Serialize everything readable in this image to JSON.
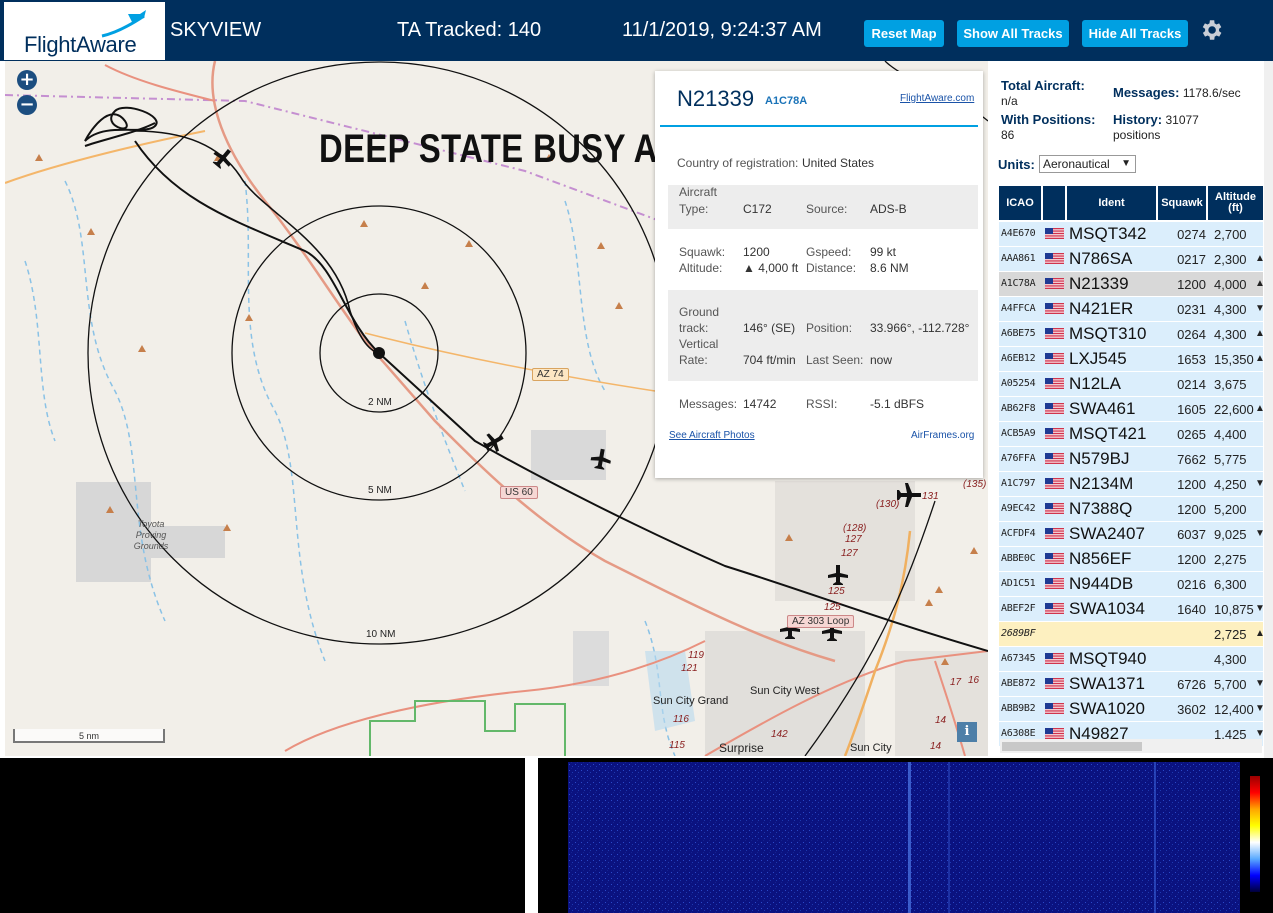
{
  "header": {
    "logo_text": "FlightAware",
    "app_name": "SKYVIEW",
    "tracked": "TA Tracked: 140",
    "datetime": "11/1/2019, 9:24:37 AM",
    "buttons": {
      "reset": "Reset Map",
      "show_all": "Show All Tracks",
      "hide_all": "Hide All Tracks"
    },
    "settings_icon": "gear-icon"
  },
  "map": {
    "zoom_in": "+",
    "zoom_out": "−",
    "banner": "DEEP STATE BUSY A",
    "scale_label": "5 nm",
    "info_label": "i",
    "ring_labels": [
      "2 NM",
      "5 NM",
      "10 NM"
    ],
    "place_labels": [
      "Toyota Proving Grounds",
      "Sun City Grand",
      "Sun City West",
      "Surprise",
      "Sun City"
    ],
    "road_labels": [
      "AZ 74",
      "US 60",
      "AZ 303 Loop"
    ],
    "exit_labels": [
      "(135)",
      "(130)",
      "131",
      "(128)",
      "127",
      "127",
      "125",
      "125",
      "119",
      "121",
      "116",
      "115",
      "142",
      "16",
      "17",
      "14",
      "14"
    ]
  },
  "popup": {
    "ident": "N21339",
    "hex": "A1C78A",
    "fa_link": "FlightAware.com",
    "country_label": "Country of registration:",
    "country": "United States",
    "aircraft_label": "Aircraft",
    "type_label": "Type:",
    "type": "C172",
    "source_label": "Source:",
    "source": "ADS-B",
    "squawk_label": "Squawk:",
    "squawk": "1200",
    "gspeed_label": "Gspeed:",
    "gspeed": "99 kt",
    "altitude_label": "Altitude:",
    "altitude": "▲ 4,000 ft",
    "distance_label": "Distance:",
    "distance": "8.6 NM",
    "ground_label": "Ground",
    "track_label": "track:",
    "track": "146° (SE)",
    "position_label": "Position:",
    "position": "33.966°, -112.728°",
    "vertical_label": "Vertical",
    "rate_label": "Rate:",
    "rate": "704 ft/min",
    "lastseen_label": "Last Seen:",
    "lastseen": "now",
    "messages_label": "Messages:",
    "messages": "14742",
    "rssi_label": "RSSI:",
    "rssi": "-5.1 dBFS",
    "photos_link": "See Aircraft Photos",
    "airframes_link": "AirFrames.org"
  },
  "stats": {
    "total_label": "Total Aircraft:",
    "total": "n/a",
    "messages_label": "Messages:",
    "messages": "1178.6/sec",
    "positions_label": "With Positions:",
    "positions": "86",
    "history_label": "History:",
    "history": "31077",
    "history_unit": "positions",
    "units_label": "Units:",
    "units": "Aeronautical"
  },
  "table": {
    "headers": {
      "icao": "ICAO",
      "ident": "Ident",
      "squawk": "Squawk",
      "altitude": "Altitude",
      "altitude_unit": "(ft)"
    },
    "rows": [
      {
        "icao": "A4E670",
        "ident": "MSQT342",
        "squawk": "0274",
        "alt": "2,700",
        "trend": ""
      },
      {
        "icao": "AAA861",
        "ident": "N786SA",
        "squawk": "0217",
        "alt": "2,300",
        "trend": "▲"
      },
      {
        "icao": "A1C78A",
        "ident": "N21339",
        "squawk": "1200",
        "alt": "4,000",
        "trend": "▲"
      },
      {
        "icao": "A4FFCA",
        "ident": "N421ER",
        "squawk": "0231",
        "alt": "4,300",
        "trend": "▼"
      },
      {
        "icao": "A6BE75",
        "ident": "MSQT310",
        "squawk": "0264",
        "alt": "4,300",
        "trend": "▲"
      },
      {
        "icao": "A6EB12",
        "ident": "LXJ545",
        "squawk": "1653",
        "alt": "15,350",
        "trend": "▲"
      },
      {
        "icao": "A05254",
        "ident": "N12LA",
        "squawk": "0214",
        "alt": "3,675",
        "trend": ""
      },
      {
        "icao": "AB62F8",
        "ident": "SWA461",
        "squawk": "1605",
        "alt": "22,600",
        "trend": "▲"
      },
      {
        "icao": "ACB5A9",
        "ident": "MSQT421",
        "squawk": "0265",
        "alt": "4,400",
        "trend": ""
      },
      {
        "icao": "A76FFA",
        "ident": "N579BJ",
        "squawk": "7662",
        "alt": "5,775",
        "trend": ""
      },
      {
        "icao": "A1C797",
        "ident": "N2134M",
        "squawk": "1200",
        "alt": "4,250",
        "trend": "▼"
      },
      {
        "icao": "A9EC42",
        "ident": "N7388Q",
        "squawk": "1200",
        "alt": "5,200",
        "trend": ""
      },
      {
        "icao": "ACFDF4",
        "ident": "SWA2407",
        "squawk": "6037",
        "alt": "9,025",
        "trend": "▼"
      },
      {
        "icao": "ABBE0C",
        "ident": "N856EF",
        "squawk": "1200",
        "alt": "2,275",
        "trend": ""
      },
      {
        "icao": "AD1C51",
        "ident": "N944DB",
        "squawk": "0216",
        "alt": "6,300",
        "trend": ""
      },
      {
        "icao": "ABEF2F",
        "ident": "SWA1034",
        "squawk": "1640",
        "alt": "10,875",
        "trend": "▼"
      },
      {
        "icao": "2689BF",
        "ident": "",
        "squawk": "",
        "alt": "2,725",
        "trend": "▲"
      },
      {
        "icao": "A67345",
        "ident": "MSQT940",
        "squawk": "",
        "alt": "4,300",
        "trend": ""
      },
      {
        "icao": "ABE872",
        "ident": "SWA1371",
        "squawk": "6726",
        "alt": "5,700",
        "trend": "▼"
      },
      {
        "icao": "ABB9B2",
        "ident": "SWA1020",
        "squawk": "3602",
        "alt": "12,400",
        "trend": "▼"
      },
      {
        "icao": "A6308E",
        "ident": "N49827",
        "squawk": "",
        "alt": "1,425",
        "trend": "▼"
      }
    ]
  }
}
